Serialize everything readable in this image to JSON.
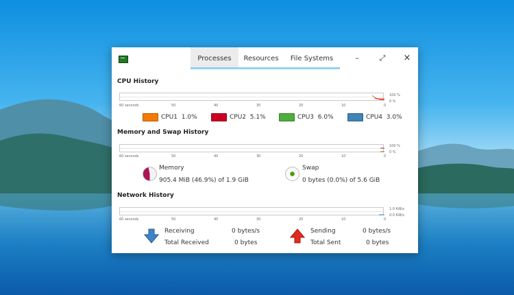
{
  "window": {
    "tabs": [
      {
        "label": "Processes",
        "active": true
      },
      {
        "label": "Resources",
        "active": false
      },
      {
        "label": "File Systems",
        "active": false
      }
    ],
    "controls": {
      "minimize": "–",
      "maximize": "⤢",
      "close": "×"
    }
  },
  "x_ticks": [
    "60 seconds",
    "50",
    "40",
    "30",
    "20",
    "10",
    "0"
  ],
  "cpu": {
    "title": "CPU History",
    "y_ticks": [
      "100 %",
      "0 %"
    ],
    "legend": [
      {
        "label": "CPU1",
        "value": "1.0%",
        "color": "#f57900"
      },
      {
        "label": "CPU2",
        "value": "5.1%",
        "color": "#cc0022"
      },
      {
        "label": "CPU3",
        "value": "6.0%",
        "color": "#4eae3a"
      },
      {
        "label": "CPU4",
        "value": "3.0%",
        "color": "#3f84b5"
      }
    ]
  },
  "memory": {
    "title": "Memory and Swap History",
    "y_ticks": [
      "100 %",
      "0 %"
    ],
    "mem": {
      "label": "Memory",
      "detail": "905.4 MiB (46.9%) of 1.9 GiB",
      "color": "#ad1457",
      "percent": 46.9
    },
    "swap": {
      "label": "Swap",
      "detail": "0 bytes (0.0%) of 5.6 GiB",
      "color": "#4e9a06",
      "percent": 0.0
    }
  },
  "network": {
    "title": "Network History",
    "y_ticks": [
      "1.0 KiB/s",
      "0.0 KiB/s"
    ],
    "receiving": {
      "label": "Receiving",
      "value": "0 bytes/s",
      "total_label": "Total Received",
      "total_value": "0 bytes",
      "color": "#3f84c8"
    },
    "sending": {
      "label": "Sending",
      "value": "0 bytes/s",
      "total_label": "Total Sent",
      "total_value": "0 bytes",
      "color": "#e22b1f"
    }
  }
}
